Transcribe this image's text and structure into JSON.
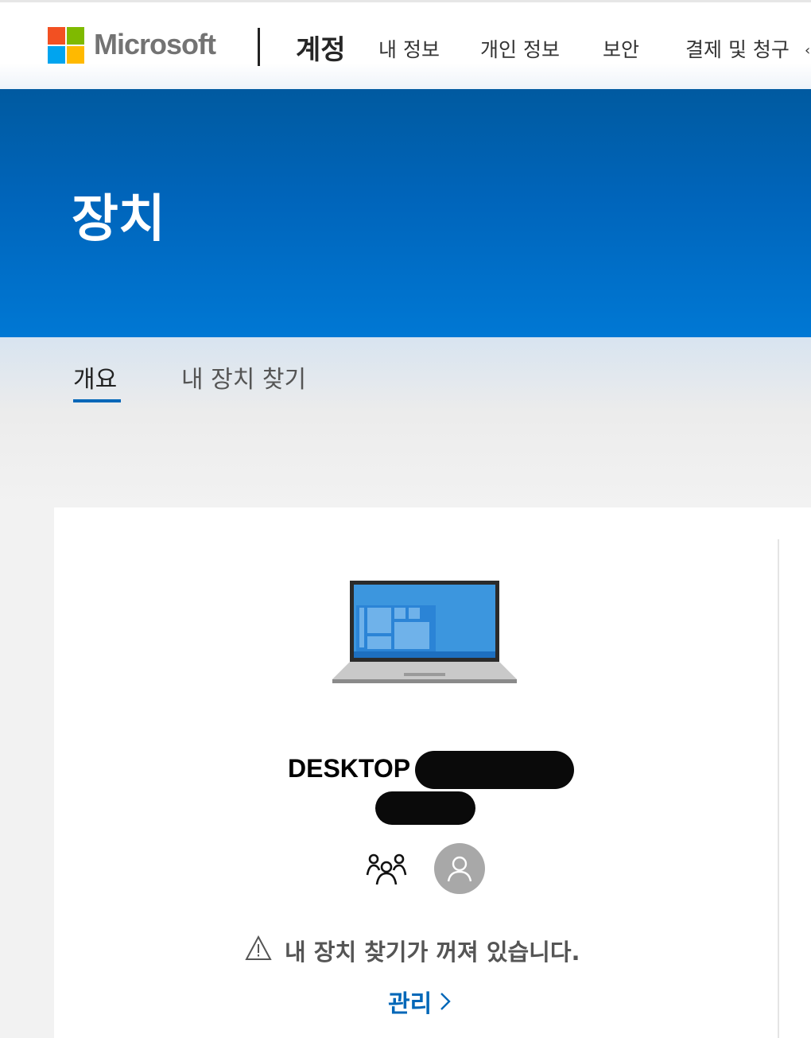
{
  "header": {
    "brand": "Microsoft",
    "section_title": "계정",
    "nav": [
      "내 정보",
      "개인 정보",
      "보안",
      "결제 및 청구"
    ],
    "logo_colors": [
      "#f25022",
      "#7fba00",
      "#00a4ef",
      "#ffb900"
    ]
  },
  "hero": {
    "title": "장치"
  },
  "tabs": {
    "overview": "개요",
    "find_my_device": "내 장치 찾기"
  },
  "device": {
    "name_prefix": "DESKTOP",
    "icons": [
      "laptop-icon",
      "family-icon",
      "user-avatar-icon"
    ],
    "warning": "내 장치 찾기가 꺼져 있습니다.",
    "manage_link": "관리"
  },
  "colors": {
    "accent": "#0067b8",
    "hero": "#0078d4"
  }
}
